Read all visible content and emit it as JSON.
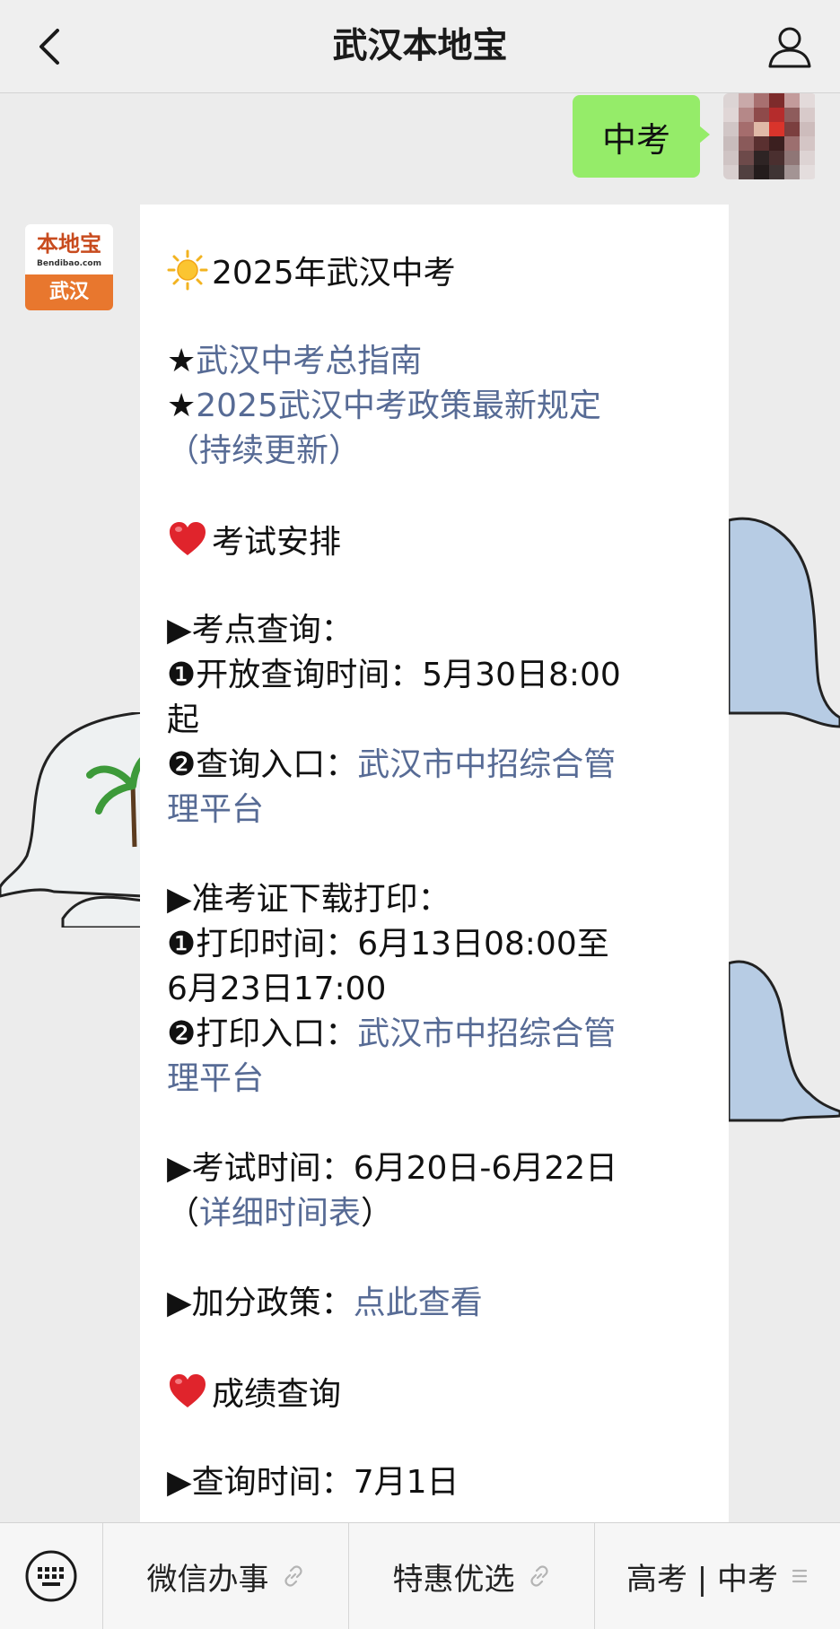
{
  "nav": {
    "title": "武汉本地宝"
  },
  "outgoing": {
    "text": "中考"
  },
  "official_account": {
    "logo_top": "本地宝",
    "logo_sub": "Bendibao.com",
    "logo_city": "武汉"
  },
  "message": {
    "title": "2025年武汉中考",
    "link_guide": "武汉中考总指南",
    "link_policy_line1": "2025武汉中考政策最新规定",
    "link_policy_line2": "（持续更新）",
    "section_exam": "考试安排",
    "kaodian_heading": "▶考点查询：",
    "kaodian_time_label": "❶开放查询时间：",
    "kaodian_time_value": "5月30日8:00",
    "kaodian_time_cont": "起",
    "kaodian_entry_label": "❷查询入口：",
    "kaodian_entry_link1": "武汉市中招综合管",
    "kaodian_entry_link2": "理平台",
    "admit_heading": "▶准考证下载打印：",
    "admit_time_label": "❶打印时间：",
    "admit_time_value": "6月13日08:00至",
    "admit_time_cont": "6月23日17:00",
    "admit_entry_label": "❷打印入口：",
    "admit_entry_link1": "武汉市中招综合管",
    "admit_entry_link2": "理平台",
    "exam_time_label": "▶考试时间：",
    "exam_time_value": "6月20日-6月22日",
    "exam_time_open": "（",
    "exam_time_link": "详细时间表",
    "exam_time_close": "）",
    "bonus_label": "▶加分政策：",
    "bonus_link": "点此查看",
    "section_score": "成绩查询",
    "score_time_label": "▶查询时间：",
    "score_time_value": "7月1日"
  },
  "menu": {
    "items": [
      {
        "label": "微信办事",
        "icon": "link-icon"
      },
      {
        "label": "特惠优选",
        "icon": "link-icon"
      },
      {
        "label": "高考 | 中考",
        "icon": "menu-lines-icon"
      }
    ]
  },
  "colors": {
    "link": "#576b95",
    "bubble_green": "#95ec69",
    "heart": "#e0242c",
    "brand_orange": "#e8772e"
  }
}
